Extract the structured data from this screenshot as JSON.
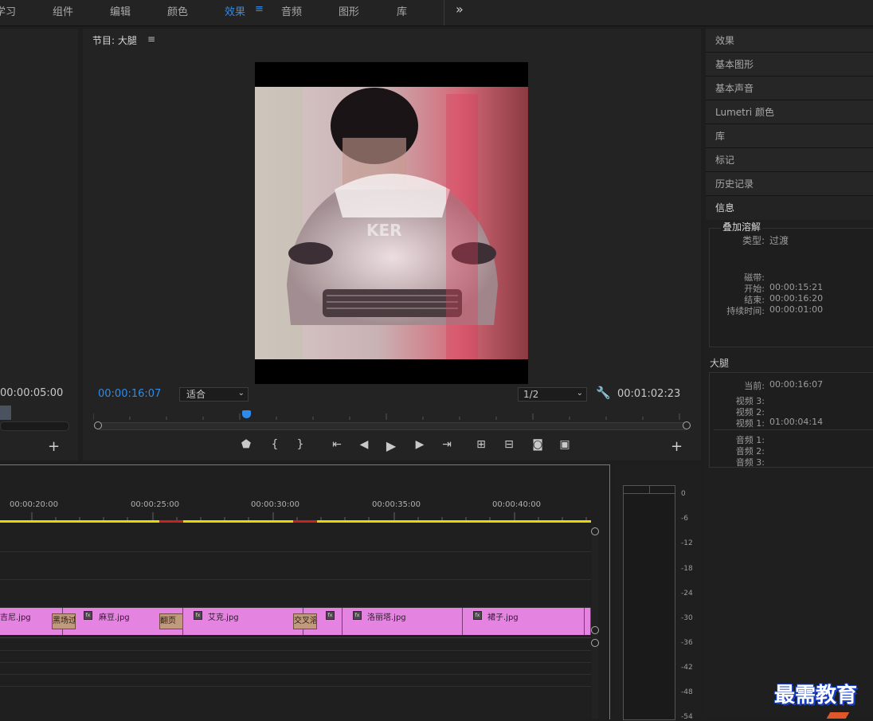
{
  "workspace_tabs": {
    "learn": "学习",
    "assembly": "组件",
    "editing": "编辑",
    "color": "颜色",
    "effects": "效果",
    "effects_menu": "≡",
    "audio": "音频",
    "graphics": "图形",
    "libraries": "库",
    "more": "»"
  },
  "source_panel": {
    "timecode": "00:00:05:00",
    "add_button": "+"
  },
  "program_monitor": {
    "title": "节目: 大腿",
    "menu_icon": "≡",
    "current_time": "00:00:16:07",
    "zoom": "适合",
    "resolution": "1/2",
    "duration": "00:01:02:23",
    "add_button": "+",
    "preview_text": "KER"
  },
  "right_panels": {
    "effects": "效果",
    "essential_graphics": "基本图形",
    "essential_sound": "基本声音",
    "lumetri_color": "Lumetri 颜色",
    "libraries": "库",
    "markers": "标记",
    "history": "历史记录",
    "info": "信息"
  },
  "info": {
    "item_name": "叠加溶解",
    "type_key": "类型:",
    "type_val": "过渡",
    "tape_key": "磁带:",
    "start_key": "开始:",
    "start_val": "00:00:15:21",
    "end_key": "结束:",
    "end_val": "00:00:16:20",
    "duration_key": "持续时间:",
    "duration_val": "00:00:01:00",
    "sequence_name": "大腿",
    "current_key": "当前:",
    "current_val": "00:00:16:07",
    "video3_key": "视频 3:",
    "video2_key": "视频 2:",
    "video1_key": "视频 1:",
    "video1_val": "01:00:04:14",
    "audio1_key": "音频 1:",
    "audio2_key": "音频 2:",
    "audio3_key": "音频 3:"
  },
  "timeline": {
    "ruler": [
      "00:00:20:00",
      "00:00:25:00",
      "00:00:30:00",
      "00:00:35:00",
      "00:00:40:00"
    ],
    "clips": {
      "c0": "吉尼.jpg",
      "c1": "麻豆.jpg",
      "c2": "艾克.jpg",
      "c3": "洛丽塔.jpg",
      "c4": "裙子.jpg"
    },
    "transitions": {
      "t1": "黑场过",
      "t2": "翻页",
      "t3": "交叉溶"
    },
    "fx_badge": "fx"
  },
  "audio_meter": {
    "labels": [
      "0",
      "-6",
      "-12",
      "-18",
      "-24",
      "-30",
      "-36",
      "-42",
      "-48",
      "-54"
    ]
  },
  "watermark": "最需教育",
  "colors": {
    "accent_blue": "#2d8ceb",
    "clip_pink": "#e584e0",
    "transition_tan": "#c09a7c",
    "work_area_yellow": "#e6d800",
    "render_red": "#c92020"
  }
}
